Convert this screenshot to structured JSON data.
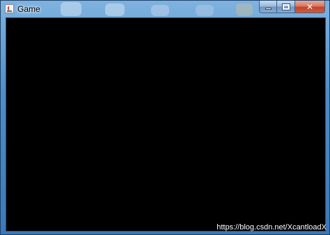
{
  "window": {
    "title": "Game",
    "icon": "java-cup-icon",
    "client_background": "#000000"
  },
  "caption_buttons": {
    "minimize_icon": "minimize-icon",
    "maximize_icon": "maximize-icon",
    "close_label": "✕"
  },
  "watermark": {
    "text": "https://blog.csdn.net/XcantloadX"
  }
}
